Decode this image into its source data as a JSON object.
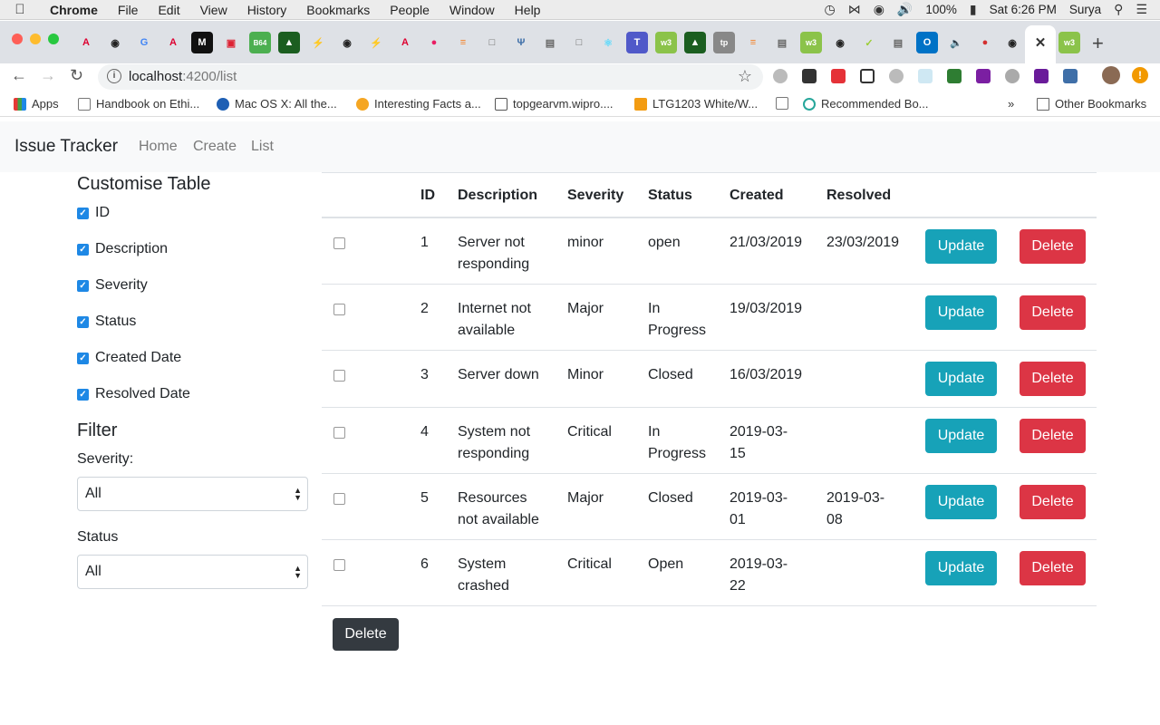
{
  "menubar": {
    "app": "Chrome",
    "items": [
      "File",
      "Edit",
      "View",
      "History",
      "Bookmarks",
      "People",
      "Window",
      "Help"
    ],
    "battery": "100%",
    "clock": "Sat 6:26 PM",
    "user": "Surya"
  },
  "browser": {
    "url_host": "localhost",
    "url_path": ":4200/list"
  },
  "bookmarks": {
    "items": [
      "Apps",
      "Handbook on Ethi...",
      "Mac OS X: All the...",
      "Interesting Facts a...",
      "topgearvm.wipro....",
      "LTG1203 White/W...",
      "Recommended Bo..."
    ],
    "overflow": "»",
    "other": "Other Bookmarks"
  },
  "app": {
    "brand": "Issue Tracker",
    "nav": [
      "Home",
      "Create",
      "List"
    ]
  },
  "sidebar": {
    "customise_heading": "Customise Table",
    "columns": [
      "ID",
      "Description",
      "Severity",
      "Status",
      "Created Date",
      "Resolved Date"
    ],
    "filter_heading": "Filter",
    "severity_label": "Severity:",
    "severity_value": "All",
    "status_label": "Status",
    "status_value": "All"
  },
  "table": {
    "headers": [
      "ID",
      "Description",
      "Severity",
      "Status",
      "Created",
      "Resolved"
    ],
    "rows": [
      {
        "id": "1",
        "desc1": "Server not",
        "desc2": "responding",
        "severity": "minor",
        "status1": "open",
        "status2": "",
        "created1": "21/03/2019",
        "created2": "",
        "resolved1": "23/03/2019",
        "resolved2": ""
      },
      {
        "id": "2",
        "desc1": "Internet not",
        "desc2": "available",
        "severity": "Major",
        "status1": "In",
        "status2": "Progress",
        "created1": "19/03/2019",
        "created2": "",
        "resolved1": "",
        "resolved2": ""
      },
      {
        "id": "3",
        "desc1": "Server down",
        "desc2": "",
        "severity": "Minor",
        "status1": "Closed",
        "status2": "",
        "created1": "16/03/2019",
        "created2": "",
        "resolved1": "",
        "resolved2": ""
      },
      {
        "id": "4",
        "desc1": "System not",
        "desc2": "responding",
        "severity": "Critical",
        "status1": "In",
        "status2": "Progress",
        "created1": "2019-03-",
        "created2": "15",
        "resolved1": "",
        "resolved2": ""
      },
      {
        "id": "5",
        "desc1": "Resources",
        "desc2": "not available",
        "severity": "Major",
        "status1": "Closed",
        "status2": "",
        "created1": "2019-03-",
        "created2": "01",
        "resolved1": "2019-03-",
        "resolved2": "08"
      },
      {
        "id": "6",
        "desc1": "System",
        "desc2": "crashed",
        "severity": "Critical",
        "status1": "Open",
        "status2": "",
        "created1": "2019-03-",
        "created2": "22",
        "resolved1": "",
        "resolved2": ""
      }
    ],
    "update_label": "Update",
    "delete_label": "Delete",
    "bulk_delete_label": "Delete"
  }
}
